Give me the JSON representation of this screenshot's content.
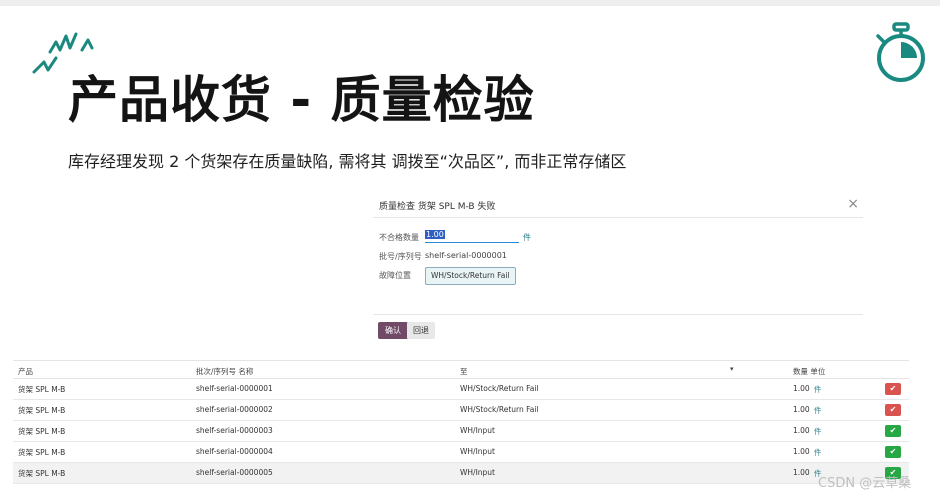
{
  "slide": {
    "title": "产品收货 - 质量检验",
    "subtitle": "库存经理发现 2 个货架存在质量缺陷, 需将其 调拨至“次品区”, 而非正常存储区",
    "accent_color": "#1a8a80",
    "decor_icons": [
      "sparks-icon",
      "stopwatch-icon"
    ]
  },
  "dialog": {
    "title": "质量检查 货架 SPL M-B 失败",
    "close_glyph": "×",
    "qty_label": "不合格数量",
    "qty_value": "1.00",
    "qty_unit": "件",
    "serial_label": "批号/序列号",
    "serial_value": "shelf-serial-0000001",
    "location_label": "故障位置",
    "location_value": "WH/Stock/Return Fail",
    "confirm_label": "确认",
    "cancel_label": "回退"
  },
  "table": {
    "headers": {
      "product": "产品",
      "serial": "批次/序列号 名称",
      "to": "至",
      "sort_glyph": "▾",
      "qty_unit": "数量 单位"
    },
    "rows": [
      {
        "product": "货架 SPL M-B",
        "serial": "shelf-serial-0000001",
        "to": "WH/Stock/Return Fail",
        "qty": "1.00",
        "unit": "件",
        "status": "fail",
        "icon": "✔"
      },
      {
        "product": "货架 SPL M-B",
        "serial": "shelf-serial-0000002",
        "to": "WH/Stock/Return Fail",
        "qty": "1.00",
        "unit": "件",
        "status": "fail",
        "icon": "✔"
      },
      {
        "product": "货架 SPL M-B",
        "serial": "shelf-serial-0000003",
        "to": "WH/Input",
        "qty": "1.00",
        "unit": "件",
        "status": "pass",
        "icon": "✔"
      },
      {
        "product": "货架 SPL M-B",
        "serial": "shelf-serial-0000004",
        "to": "WH/Input",
        "qty": "1.00",
        "unit": "件",
        "status": "pass",
        "icon": "✔"
      },
      {
        "product": "货架 SPL M-B",
        "serial": "shelf-serial-0000005",
        "to": "WH/Input",
        "qty": "1.00",
        "unit": "件",
        "status": "pass",
        "icon": "✔"
      }
    ],
    "status_colors": {
      "fail": "#d9534f",
      "pass": "#28a745"
    }
  },
  "watermark": "CSDN @云草桑"
}
